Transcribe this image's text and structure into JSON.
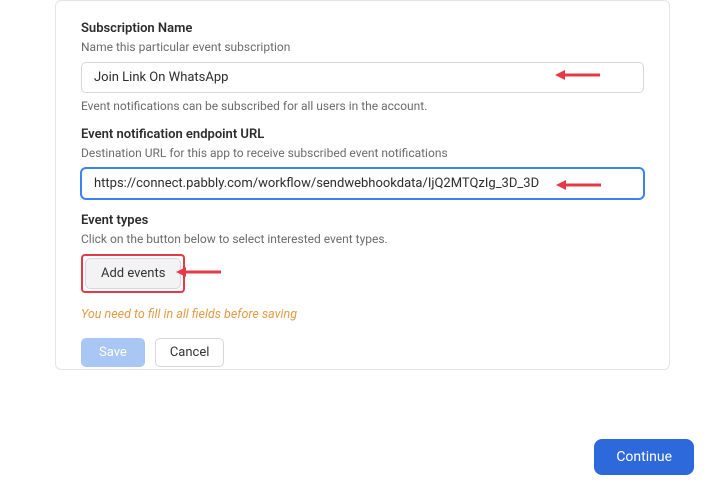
{
  "subscription": {
    "label": "Subscription Name",
    "desc": "Name this particular event subscription",
    "value": "Join Link On WhatsApp",
    "help": "Event notifications can be subscribed for all users in the account."
  },
  "endpoint": {
    "label": "Event notification endpoint URL",
    "desc": "Destination URL for this app to receive subscribed event notifications",
    "value": "https://connect.pabbly.com/workflow/sendwebhookdata/IjQ2MTQzIg_3D_3D"
  },
  "event_types": {
    "label": "Event types",
    "desc": "Click on the button below to select interested event types.",
    "add_button": "Add events"
  },
  "warning": "You need to fill in all fields before saving",
  "buttons": {
    "save": "Save",
    "cancel": "Cancel",
    "continue": "Continue"
  }
}
